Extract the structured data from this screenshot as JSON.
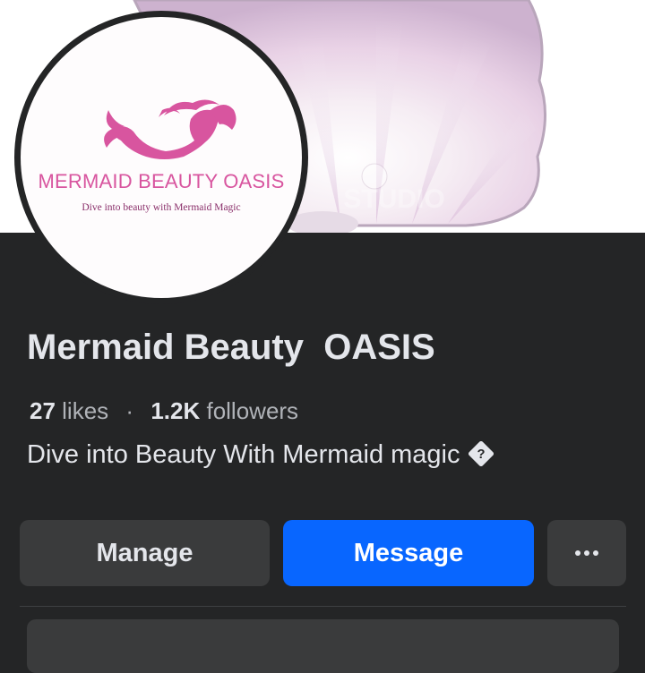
{
  "page": {
    "name": "Mermaid Beauty  OASIS",
    "likes_count": "27",
    "likes_label": "likes",
    "separator": "·",
    "followers_count": "1.2K",
    "followers_label": "followers",
    "bio": "Dive into Beauty With Mermaid magic",
    "bio_emoji_fallback": "?"
  },
  "logo": {
    "title": "MERMAID BEAUTY OASIS",
    "tagline": "Dive into beauty with Mermaid Magic",
    "color": "#d8559f"
  },
  "cover": {
    "watermark_text": "STUDIO"
  },
  "actions": {
    "manage_label": "Manage",
    "message_label": "Message",
    "more_icon": "more-horizontal-icon"
  },
  "colors": {
    "background": "#242526",
    "primary_button": "#0866ff",
    "secondary_button": "#3a3b3c",
    "text_primary": "#e4e6eb",
    "text_secondary": "#b0b3b8"
  }
}
